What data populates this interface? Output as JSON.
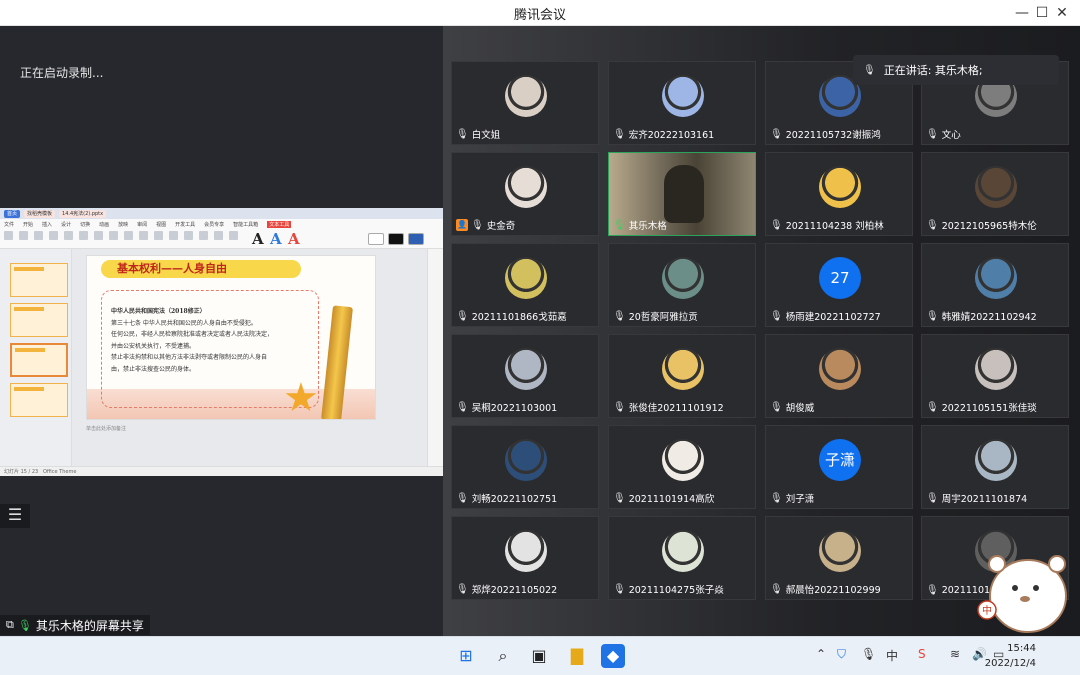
{
  "window": {
    "title": "腾讯会议"
  },
  "left": {
    "recording_text": "正在启动录制...",
    "screen_share_label": "其乐木格的屏幕共享",
    "wps": {
      "tabs": [
        "首页",
        "找稻壳模板",
        "14.4宪法(2).pptx"
      ],
      "menu": [
        "文件",
        "开始",
        "插入",
        "设计",
        "切换",
        "动画",
        "放映",
        "审阅",
        "视图",
        "开发工具",
        "会员专享",
        "智能工具箱",
        "文本工具"
      ],
      "slide_title": "基本权利——人身自由",
      "slide_heading": "中华人民共和国宪法（2018修正）",
      "slide_lines": [
        "第三十七条 中华人民共和国公民的人身自由不受侵犯。",
        "任何公民，非经人民检察院批准或者决定或者人民法院决定，",
        "并由公安机关执行，不受逮捕。",
        "禁止非法拘禁和以其他方法非法剥夺或者限制公民的人身自",
        "由，禁止非法搜查公民的身体。"
      ],
      "notes_placeholder": "单击此处添加备注",
      "status_page": "幻灯片 15 / 23",
      "status_theme": "Office Theme"
    }
  },
  "right": {
    "speaking_text": "正在讲话: 其乐木格;",
    "participants": [
      {
        "name": "白文姐",
        "avatar": "photo",
        "color": "#d9cfc5"
      },
      {
        "name": "宏齐20222103161",
        "avatar": "photo",
        "color": "#9db6e6"
      },
      {
        "name": "20221105732谢振鸿",
        "avatar": "photo",
        "color": "#3c63a6"
      },
      {
        "name": "文心",
        "avatar": "photo",
        "color": "#7d7d7d"
      },
      {
        "name": "史金奇",
        "avatar": "photo",
        "color": "#e5ddd6",
        "host": true
      },
      {
        "name": "其乐木格",
        "avatar": "video",
        "color": "#8a7f6b",
        "active": true
      },
      {
        "name": "20211104238 刘柏林",
        "avatar": "photo",
        "color": "#efc14a"
      },
      {
        "name": "20212105965特木伦",
        "avatar": "photo",
        "color": "#5a4636"
      },
      {
        "name": "20211101866戈茹嘉",
        "avatar": "photo",
        "color": "#d1c05d"
      },
      {
        "name": "20哲豪阿雅拉贡",
        "avatar": "photo",
        "color": "#6b8e88"
      },
      {
        "name": "杨雨建20221102727",
        "avatar": "text",
        "text": "27",
        "color": "#0f70f0"
      },
      {
        "name": "韩雅婧20221102942",
        "avatar": "photo",
        "color": "#4f7ea8"
      },
      {
        "name": "吴桐20221103001",
        "avatar": "photo",
        "color": "#b0b7c4"
      },
      {
        "name": "张俊佳20211101912",
        "avatar": "photo",
        "color": "#e8c265"
      },
      {
        "name": "胡俊威",
        "avatar": "photo",
        "color": "#b88a5e"
      },
      {
        "name": "20221105151张佳琰",
        "avatar": "photo",
        "color": "#c7c0bd"
      },
      {
        "name": "刘畅20221102751",
        "avatar": "photo",
        "color": "#2e4e7a"
      },
      {
        "name": "20211101914高欣",
        "avatar": "photo",
        "color": "#f0ebe5"
      },
      {
        "name": "刘子潇",
        "avatar": "text",
        "text": "子潇",
        "color": "#0f70f0"
      },
      {
        "name": "周宇20211101874",
        "avatar": "photo",
        "color": "#a9b7c4"
      },
      {
        "name": "郑烨20221105022",
        "avatar": "photo",
        "color": "#e3e3e3"
      },
      {
        "name": "20211104275张子焱",
        "avatar": "photo",
        "color": "#dde3d5"
      },
      {
        "name": "郝晨怡20221102999",
        "avatar": "photo",
        "color": "#c7b18b"
      },
      {
        "name": "20211101",
        "avatar": "photo",
        "color": "#5f5f5f"
      }
    ]
  },
  "taskbar": {
    "time": "15:44",
    "date": "2022/12/4",
    "ime": "中"
  }
}
